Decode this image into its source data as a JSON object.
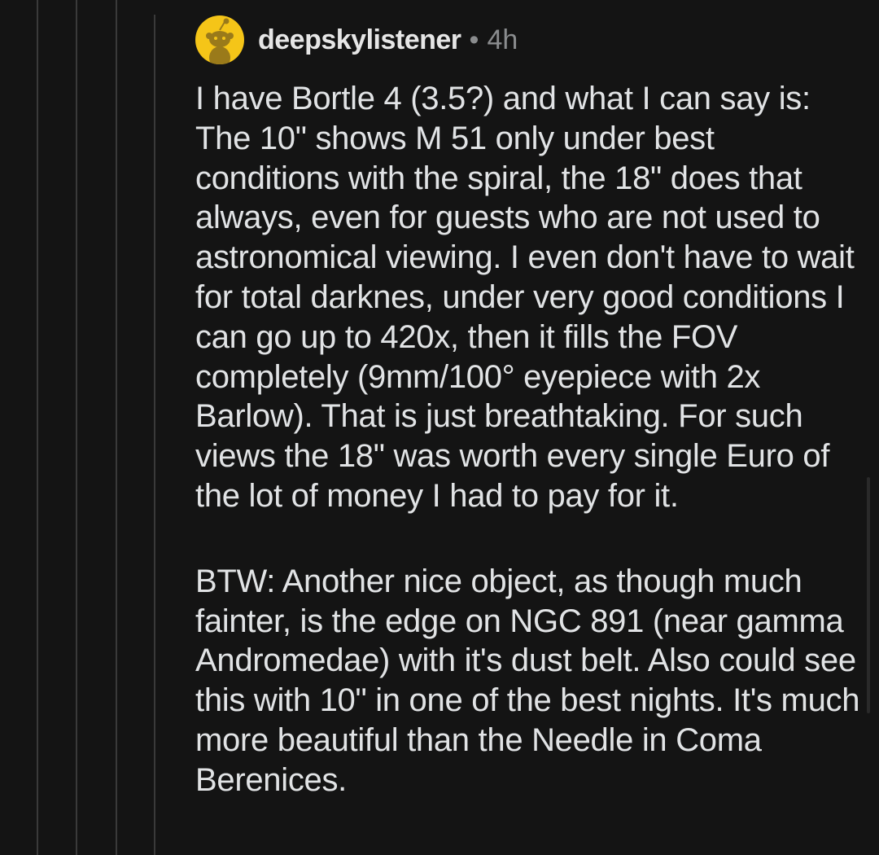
{
  "comment": {
    "username": "deepskylistener",
    "separator": "•",
    "age": "4h",
    "avatar_icon": "snoo-avatar-icon",
    "avatar_color": "#f5c518",
    "paragraphs": [
      "I have Bortle 4 (3.5?) and what I can say is: The 10\" shows M 51 only under best conditions with the spiral, the 18\" does that always, even for guests who are not used to astronomical viewing. I even don't have to wait for total darknes, under very good conditions I can go up to 420x, then it fills the FOV completely (9mm/100° eyepiece with 2x Barlow). That is just breathtaking. For such views the 18\" was worth every single Euro of the lot of money I had to pay for it.",
      "BTW: Another nice object, as though much fainter, is the edge on NGC 891 (near gamma Andromedae) with it's dust belt. Also could see this with 10\" in one of the best nights. It's much more beautiful than the Needle in Coma Berenices."
    ]
  }
}
